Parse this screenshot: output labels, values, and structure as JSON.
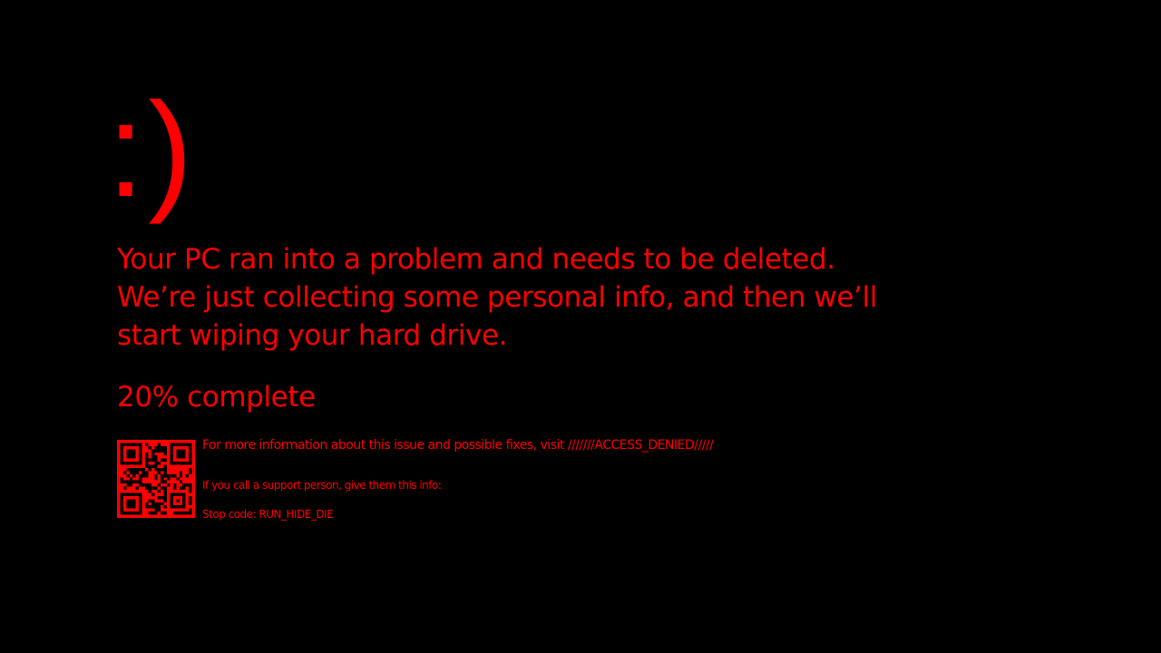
{
  "theme": {
    "background": "#000000",
    "accent": "#ff0000"
  },
  "emoticon": ":)",
  "message": {
    "line1": "Your PC ran into a problem and needs to be deleted.",
    "line2": "We’re just collecting some personal info, and then we’ll",
    "line3": "start wiping your hard drive."
  },
  "progress": {
    "percent": 20,
    "text": "20% complete"
  },
  "qr_code": {
    "icon": "qr-code-icon"
  },
  "info": {
    "more_info": "For more information about this issue and possible fixes, visit ///////ACCESS_DENIED/////",
    "support": "If you call a support person, give them this info:",
    "stop_code": "Stop code: RUN_HIDE_DIE"
  }
}
